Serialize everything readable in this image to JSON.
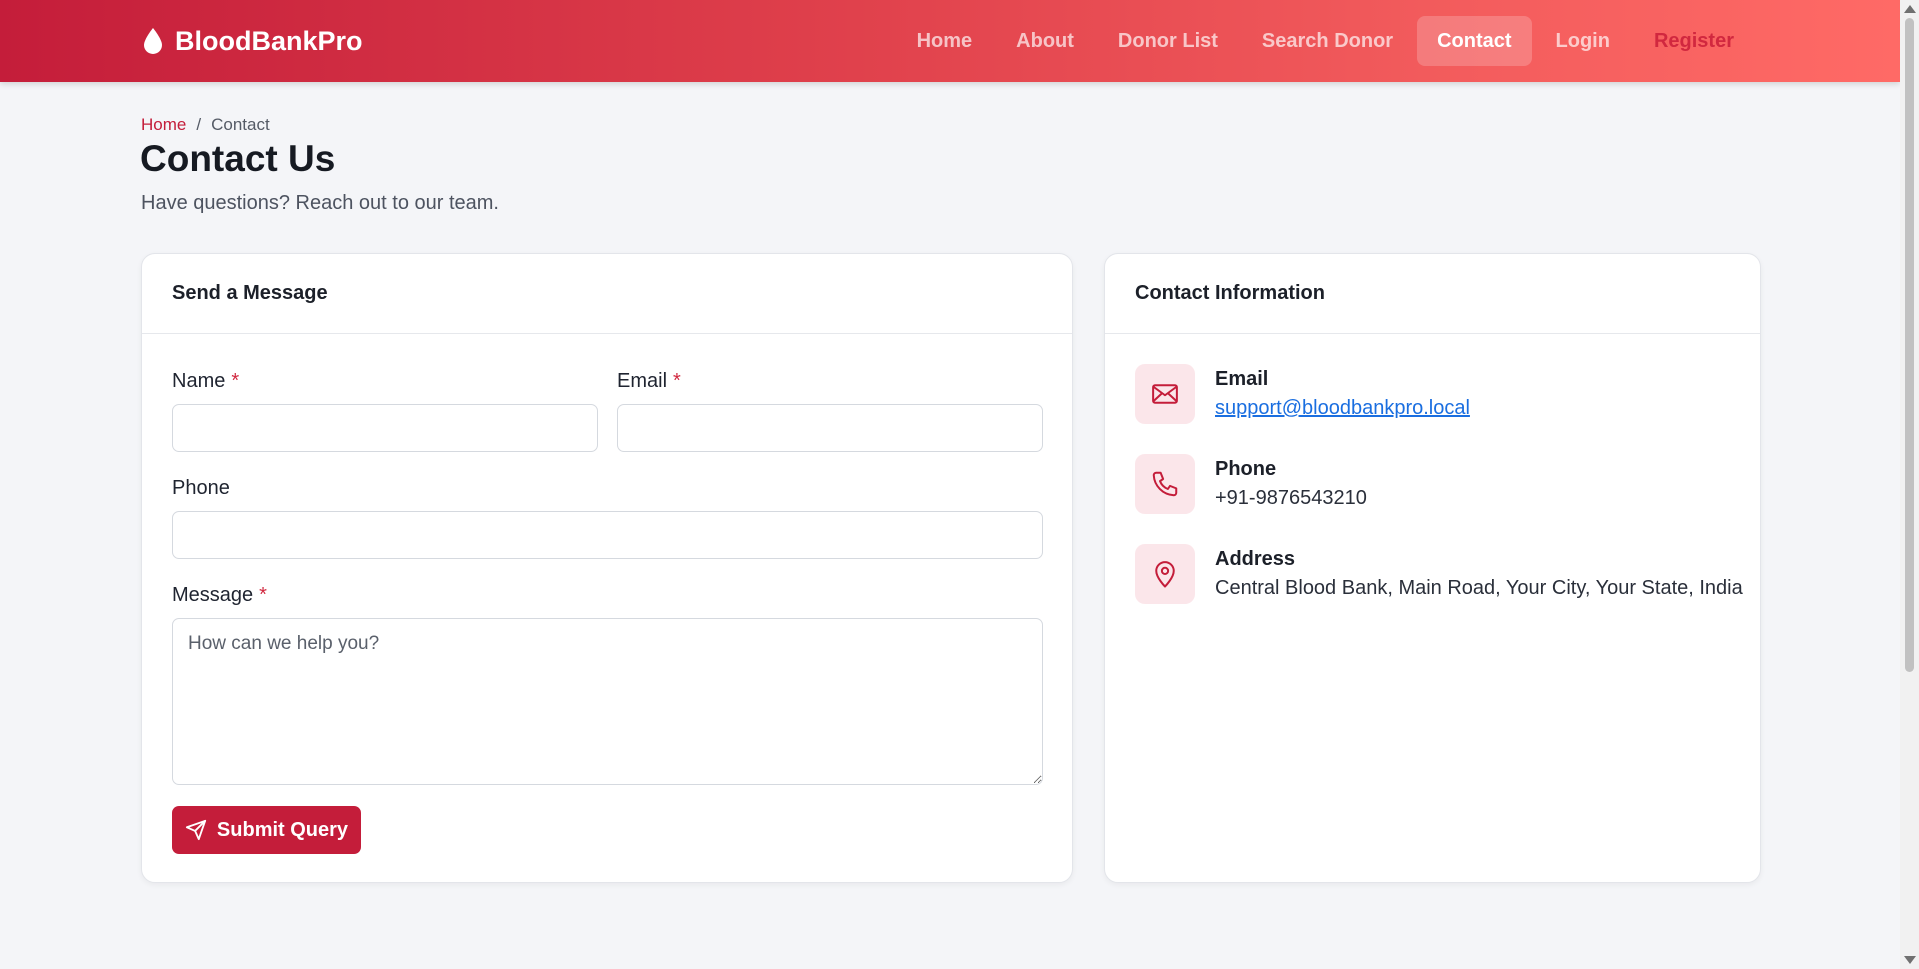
{
  "brand": {
    "name": "BloodBankPro",
    "icon": "blood-drop-icon"
  },
  "nav": {
    "items": [
      {
        "label": "Home"
      },
      {
        "label": "About"
      },
      {
        "label": "Donor List"
      },
      {
        "label": "Search Donor"
      },
      {
        "label": "Contact",
        "active": true
      },
      {
        "label": "Login"
      },
      {
        "label": "Register"
      }
    ]
  },
  "breadcrumb": {
    "home": "Home",
    "separator": "/",
    "current": "Contact"
  },
  "page": {
    "title": "Contact Us",
    "subtitle": "Have questions? Reach out to our team."
  },
  "form": {
    "heading": "Send a Message",
    "name_label": "Name",
    "email_label": "Email",
    "phone_label": "Phone",
    "message_label": "Message",
    "required_mark": "*",
    "name_value": "",
    "email_value": "",
    "phone_value": "",
    "message_placeholder": "How can we help you?",
    "submit_label": "Submit Query",
    "submit_icon": "send-icon"
  },
  "info": {
    "heading": "Contact Information",
    "email_title": "Email",
    "email_value": "support@bloodbankpro.local",
    "email_icon": "mail-icon",
    "phone_title": "Phone",
    "phone_value": "+91-9876543210",
    "phone_icon": "phone-icon",
    "address_title": "Address",
    "address_value": "Central Blood Bank, Main Road, Your City, Your State, India",
    "address_icon": "map-pin-icon"
  },
  "colors": {
    "primary": "#c41d3a",
    "link": "#1a6ee0",
    "icon_bg": "#fbe6ea"
  }
}
